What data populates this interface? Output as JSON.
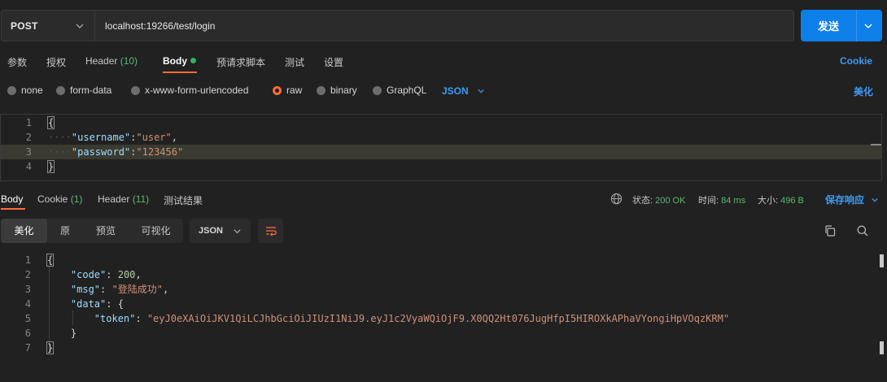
{
  "request": {
    "method": "POST",
    "url": "localhost:19266/test/login",
    "send_label": "发送"
  },
  "request_tabs": [
    {
      "label": "参数"
    },
    {
      "label": "授权"
    },
    {
      "label": "Header",
      "count": "(10)"
    },
    {
      "label": "Body",
      "active": true
    },
    {
      "label": "预请求脚本"
    },
    {
      "label": "测试"
    },
    {
      "label": "设置"
    }
  ],
  "cookie_link": "Cookie",
  "body_types": [
    "none",
    "form-data",
    "x-www-form-urlencoded",
    "raw",
    "binary",
    "GraphQL"
  ],
  "body_type_selected": "raw",
  "body_format": "JSON",
  "beautify_link": "美化",
  "request_body": {
    "line_numbers": [
      "1",
      "2",
      "3",
      "4"
    ],
    "open_brace": "{",
    "close_brace": "}",
    "username_key": "\"username\"",
    "username_value": "\"user\"",
    "password_key": "\"password\"",
    "password_value": "\"123456\""
  },
  "response_tabs": [
    {
      "label": "Body",
      "active": true
    },
    {
      "label": "Cookie",
      "count": "(1)"
    },
    {
      "label": "Header",
      "count": "(11)"
    },
    {
      "label": "测试结果"
    }
  ],
  "response_status": {
    "status_label": "状态:",
    "status_value": "200 OK",
    "time_label": "时间:",
    "time_value": "84 ms",
    "size_label": "大小:",
    "size_value": "496 B"
  },
  "save_response_label": "保存响应",
  "view_modes": [
    "美化",
    "原",
    "预览",
    "可视化"
  ],
  "view_mode_selected": "美化",
  "response_format": "JSON",
  "response_body": {
    "line_numbers": [
      "1",
      "2",
      "3",
      "4",
      "5",
      "6",
      "7"
    ],
    "open_brace": "{",
    "close_brace": "}",
    "code_key": "\"code\"",
    "code_value": "200",
    "msg_key": "\"msg\"",
    "msg_value": "\"登陆成功\"",
    "data_key": "\"data\"",
    "token_key": "\"token\"",
    "token_value": "\"eyJ0eXAiOiJKV1QiLCJhbGciOiJIUzI1NiJ9.eyJ1c2VyaWQiOjF9.X0QQ2Ht076JugHfpI5HIROXkAPhaVYongiHpVOqzKRM\""
  },
  "colors": {
    "accent_orange": "#ff6c37",
    "send_blue": "#0d7fe9",
    "link_blue": "#3d9bf5",
    "status_green": "#5bba6f"
  }
}
